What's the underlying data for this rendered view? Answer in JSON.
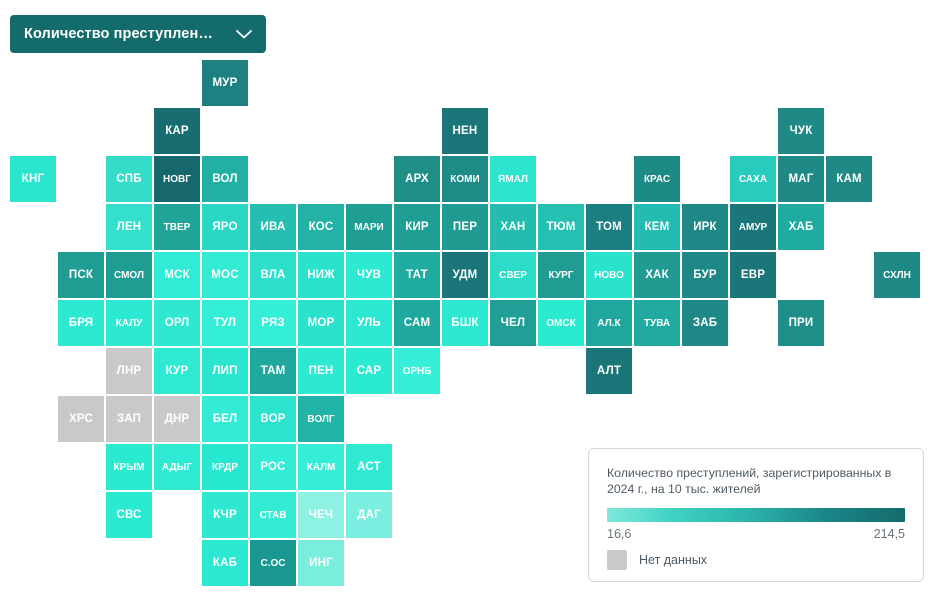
{
  "header": {
    "selector_label": "Количество преступлений, за...",
    "chevron_icon": "chevron-down-icon"
  },
  "legend": {
    "title": "Количество преступлений, зарегистрированных в 2024 г., на 10 тыс. жителей",
    "min_label": "16,6",
    "max_label": "214,5",
    "nodata_label": "Нет данных",
    "gradient_from": "#7fe8db",
    "gradient_to": "#146b6b",
    "nodata_color": "#c9c9c9"
  },
  "chart_data": {
    "type": "heatmap",
    "title": "Количество преступлений, зарегистрированных в 2024 г., на 10 тыс. жителей",
    "xlabel": "",
    "ylabel": "",
    "legend_position": "bottom-right",
    "grid": false,
    "value_range": [
      16.6,
      214.5
    ],
    "nodata_color": "#c9c9c9",
    "colorscale": [
      {
        "stop": 0.0,
        "color": "#7fe8db"
      },
      {
        "stop": 0.22,
        "color": "#3fd2c3"
      },
      {
        "stop": 0.48,
        "color": "#2ab3ab"
      },
      {
        "stop": 0.74,
        "color": "#1b8588"
      },
      {
        "stop": 1.0,
        "color": "#146b6b"
      }
    ],
    "cells": [
      {
        "label": "МУР",
        "col": 4,
        "row": 0,
        "color": "#1f8081"
      },
      {
        "label": "КАР",
        "col": 3,
        "row": 1,
        "color": "#186d70"
      },
      {
        "label": "НЕН",
        "col": 9,
        "row": 1,
        "color": "#1a7678"
      },
      {
        "label": "ЧУК",
        "col": 16,
        "row": 1,
        "color": "#1f8a85"
      },
      {
        "label": "КНГ",
        "col": 0,
        "row": 2,
        "color": "#2ae6cf"
      },
      {
        "label": "СПБ",
        "col": 2,
        "row": 2,
        "color": "#35dcc8"
      },
      {
        "label": "НОВГ",
        "col": 3,
        "row": 2,
        "color": "#16686c"
      },
      {
        "label": "ВОЛ",
        "col": 4,
        "row": 2,
        "color": "#22b0a5"
      },
      {
        "label": "АРХ",
        "col": 8,
        "row": 2,
        "color": "#1f8e87"
      },
      {
        "label": "КОМИ",
        "col": 9,
        "row": 2,
        "color": "#1e8b86"
      },
      {
        "label": "ЯМАЛ",
        "col": 10,
        "row": 2,
        "color": "#2ce5ce"
      },
      {
        "label": "КРАС",
        "col": 13,
        "row": 2,
        "color": "#1d8a85"
      },
      {
        "label": "САХА",
        "col": 15,
        "row": 2,
        "color": "#27ccbd"
      },
      {
        "label": "МАГ",
        "col": 16,
        "row": 2,
        "color": "#1f8a85"
      },
      {
        "label": "КАМ",
        "col": 17,
        "row": 2,
        "color": "#1f8a85"
      },
      {
        "label": "ЛЕН",
        "col": 2,
        "row": 3,
        "color": "#34e0cb"
      },
      {
        "label": "ТВЕР",
        "col": 3,
        "row": 3,
        "color": "#1fa698"
      },
      {
        "label": "ЯРО",
        "col": 4,
        "row": 3,
        "color": "#2ad7c4"
      },
      {
        "label": "ИВА",
        "col": 5,
        "row": 3,
        "color": "#24bfb1"
      },
      {
        "label": "КОС",
        "col": 6,
        "row": 3,
        "color": "#22b2a6"
      },
      {
        "label": "МАРИ",
        "col": 7,
        "row": 3,
        "color": "#1f9e94"
      },
      {
        "label": "КИР",
        "col": 8,
        "row": 3,
        "color": "#1f9e94"
      },
      {
        "label": "ПЕР",
        "col": 9,
        "row": 3,
        "color": "#1f9b92"
      },
      {
        "label": "ХАН",
        "col": 10,
        "row": 3,
        "color": "#23bcae"
      },
      {
        "label": "ТЮМ",
        "col": 11,
        "row": 3,
        "color": "#24c0b2"
      },
      {
        "label": "ТОМ",
        "col": 12,
        "row": 3,
        "color": "#1b7e80"
      },
      {
        "label": "КЕМ",
        "col": 13,
        "row": 3,
        "color": "#22bcb0"
      },
      {
        "label": "ИРК",
        "col": 14,
        "row": 3,
        "color": "#1d8885"
      },
      {
        "label": "АМУР",
        "col": 15,
        "row": 3,
        "color": "#1a7678"
      },
      {
        "label": "ХАБ",
        "col": 16,
        "row": 3,
        "color": "#20aba1"
      },
      {
        "label": "ПСК",
        "col": 1,
        "row": 4,
        "color": "#1f9d93"
      },
      {
        "label": "СМОЛ",
        "col": 2,
        "row": 4,
        "color": "#1f9d93"
      },
      {
        "label": "МСК",
        "col": 3,
        "row": 4,
        "color": "#30ecd6"
      },
      {
        "label": "МОС",
        "col": 4,
        "row": 4,
        "color": "#33ead3"
      },
      {
        "label": "ВЛА",
        "col": 5,
        "row": 4,
        "color": "#2de0cb"
      },
      {
        "label": "НИЖ",
        "col": 6,
        "row": 4,
        "color": "#2be2cd"
      },
      {
        "label": "ЧУВ",
        "col": 7,
        "row": 4,
        "color": "#2ce9d2"
      },
      {
        "label": "ТАТ",
        "col": 8,
        "row": 4,
        "color": "#21aca2"
      },
      {
        "label": "УДМ",
        "col": 9,
        "row": 4,
        "color": "#1a7678"
      },
      {
        "label": "СВЕР",
        "col": 10,
        "row": 4,
        "color": "#2cdcc8"
      },
      {
        "label": "КУРГ",
        "col": 11,
        "row": 4,
        "color": "#1f9d93"
      },
      {
        "label": "НОВО",
        "col": 12,
        "row": 4,
        "color": "#29e3cd"
      },
      {
        "label": "ХАК",
        "col": 13,
        "row": 4,
        "color": "#1f9b92"
      },
      {
        "label": "БУР",
        "col": 14,
        "row": 4,
        "color": "#1d8885"
      },
      {
        "label": "ЕВР",
        "col": 15,
        "row": 4,
        "color": "#1a7678"
      },
      {
        "label": "СХЛН",
        "col": 18,
        "row": 4,
        "color": "#1f8a85"
      },
      {
        "label": "БРЯ",
        "col": 1,
        "row": 5,
        "color": "#2ce9d2"
      },
      {
        "label": "КАЛУ",
        "col": 2,
        "row": 5,
        "color": "#2ce9d2"
      },
      {
        "label": "ОРЛ",
        "col": 3,
        "row": 5,
        "color": "#2fe8d1"
      },
      {
        "label": "ТУЛ",
        "col": 4,
        "row": 5,
        "color": "#33eed6"
      },
      {
        "label": "РЯЗ",
        "col": 5,
        "row": 5,
        "color": "#34efd8"
      },
      {
        "label": "МОР",
        "col": 6,
        "row": 5,
        "color": "#2ae3cd"
      },
      {
        "label": "УЛЬ",
        "col": 7,
        "row": 5,
        "color": "#2ae8d1"
      },
      {
        "label": "САМ",
        "col": 8,
        "row": 5,
        "color": "#1fa89d"
      },
      {
        "label": "БШК",
        "col": 9,
        "row": 5,
        "color": "#2ce8d1"
      },
      {
        "label": "ЧЕЛ",
        "col": 10,
        "row": 5,
        "color": "#1f9f95"
      },
      {
        "label": "ОМСК",
        "col": 11,
        "row": 5,
        "color": "#2aeacf"
      },
      {
        "label": "АЛ.К",
        "col": 12,
        "row": 5,
        "color": "#20a79d"
      },
      {
        "label": "ТУВА",
        "col": 13,
        "row": 5,
        "color": "#21aba0"
      },
      {
        "label": "ЗАБ",
        "col": 14,
        "row": 5,
        "color": "#1d8885"
      },
      {
        "label": "ПРИ",
        "col": 16,
        "row": 5,
        "color": "#1f9089"
      },
      {
        "label": "ЛНР",
        "col": 2,
        "row": 6,
        "color": "#c9c9c9",
        "nodata": true
      },
      {
        "label": "КУР",
        "col": 3,
        "row": 6,
        "color": "#2eead3"
      },
      {
        "label": "ЛИП",
        "col": 4,
        "row": 6,
        "color": "#2ae5cf"
      },
      {
        "label": "ТАМ",
        "col": 5,
        "row": 6,
        "color": "#1fa89d"
      },
      {
        "label": "ПЕН",
        "col": 6,
        "row": 6,
        "color": "#2ce9d2"
      },
      {
        "label": "САР",
        "col": 7,
        "row": 6,
        "color": "#2aeacf"
      },
      {
        "label": "ОРНБ",
        "col": 8,
        "row": 6,
        "color": "#35efd8"
      },
      {
        "label": "АЛТ",
        "col": 12,
        "row": 6,
        "color": "#1a7678"
      },
      {
        "label": "ХРС",
        "col": 1,
        "row": 7,
        "color": "#c9c9c9",
        "nodata": true
      },
      {
        "label": "ЗАП",
        "col": 2,
        "row": 7,
        "color": "#c9c9c9",
        "nodata": true
      },
      {
        "label": "ДНР",
        "col": 3,
        "row": 7,
        "color": "#c9c9c9",
        "nodata": true
      },
      {
        "label": "БЕЛ",
        "col": 4,
        "row": 7,
        "color": "#34ecd6"
      },
      {
        "label": "ВОР",
        "col": 5,
        "row": 7,
        "color": "#2ae4ce"
      },
      {
        "label": "ВОЛГ",
        "col": 6,
        "row": 7,
        "color": "#20b4a7"
      },
      {
        "label": "КРЫМ",
        "col": 2,
        "row": 8,
        "color": "#2aeacf"
      },
      {
        "label": "АДЫГ",
        "col": 3,
        "row": 8,
        "color": "#2fead3"
      },
      {
        "label": "КРДР",
        "col": 4,
        "row": 8,
        "color": "#28e7d0"
      },
      {
        "label": "РОС",
        "col": 5,
        "row": 8,
        "color": "#33ecd5"
      },
      {
        "label": "КАЛМ",
        "col": 6,
        "row": 8,
        "color": "#36edd7"
      },
      {
        "label": "АСТ",
        "col": 7,
        "row": 8,
        "color": "#2fe9d2"
      },
      {
        "label": "СВС",
        "col": 2,
        "row": 9,
        "color": "#2aeacf"
      },
      {
        "label": "КЧР",
        "col": 4,
        "row": 9,
        "color": "#2ee8d1"
      },
      {
        "label": "СТАВ",
        "col": 5,
        "row": 9,
        "color": "#34ecd5"
      },
      {
        "label": "ЧЕЧ",
        "col": 6,
        "row": 9,
        "color": "#8ef2e2"
      },
      {
        "label": "ДАГ",
        "col": 7,
        "row": 9,
        "color": "#7befdf"
      },
      {
        "label": "КАБ",
        "col": 4,
        "row": 10,
        "color": "#2ae8d1"
      },
      {
        "label": "С.ОС",
        "col": 5,
        "row": 10,
        "color": "#199892"
      },
      {
        "label": "ИНГ",
        "col": 6,
        "row": 10,
        "color": "#79eedd"
      }
    ]
  }
}
